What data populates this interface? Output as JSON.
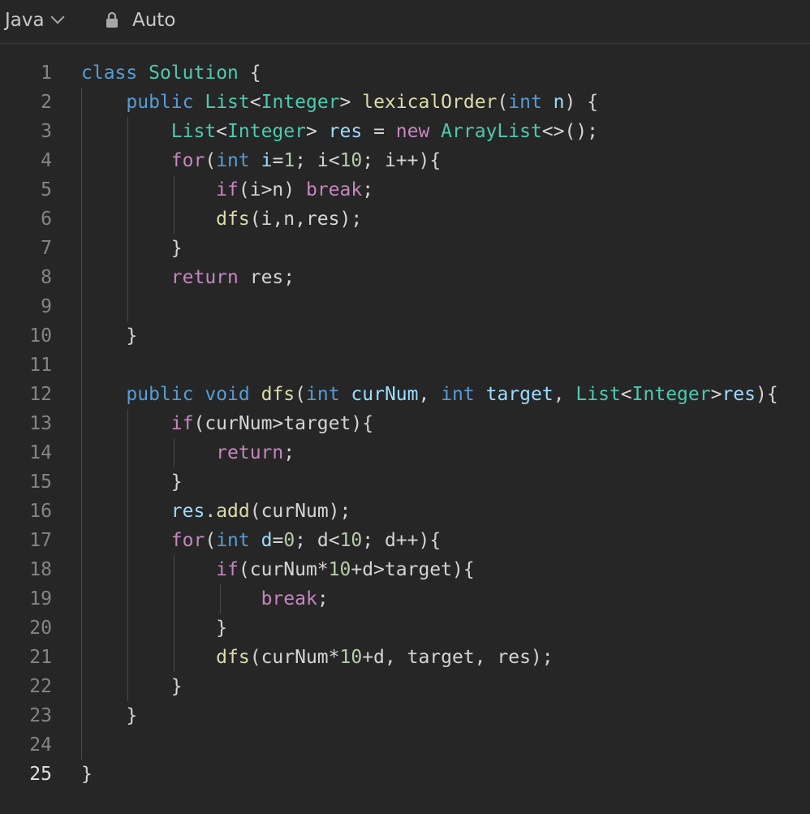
{
  "toolbar": {
    "language": "Java",
    "mode": "Auto"
  },
  "editor": {
    "active_line": 25,
    "lines": [
      {
        "n": "1",
        "tokens": [
          [
            "kw",
            "class"
          ],
          [
            "plain",
            " "
          ],
          [
            "type",
            "Solution"
          ],
          [
            "plain",
            " {"
          ]
        ]
      },
      {
        "n": "2",
        "tokens": [
          [
            "plain",
            "    "
          ],
          [
            "kw",
            "public"
          ],
          [
            "plain",
            " "
          ],
          [
            "type",
            "List"
          ],
          [
            "plain",
            "<"
          ],
          [
            "type",
            "Integer"
          ],
          [
            "plain",
            "> "
          ],
          [
            "fn",
            "lexicalOrder"
          ],
          [
            "plain",
            "("
          ],
          [
            "kw",
            "int"
          ],
          [
            "plain",
            " "
          ],
          [
            "var",
            "n"
          ],
          [
            "plain",
            ") {"
          ]
        ]
      },
      {
        "n": "3",
        "tokens": [
          [
            "plain",
            "        "
          ],
          [
            "type",
            "List"
          ],
          [
            "plain",
            "<"
          ],
          [
            "type",
            "Integer"
          ],
          [
            "plain",
            "> "
          ],
          [
            "var",
            "res"
          ],
          [
            "plain",
            " = "
          ],
          [
            "ctl",
            "new"
          ],
          [
            "plain",
            " "
          ],
          [
            "type",
            "ArrayList"
          ],
          [
            "plain",
            "<>();"
          ]
        ]
      },
      {
        "n": "4",
        "tokens": [
          [
            "plain",
            "        "
          ],
          [
            "ctl",
            "for"
          ],
          [
            "plain",
            "("
          ],
          [
            "kw",
            "int"
          ],
          [
            "plain",
            " "
          ],
          [
            "var",
            "i"
          ],
          [
            "plain",
            "="
          ],
          [
            "num",
            "1"
          ],
          [
            "plain",
            "; i<"
          ],
          [
            "num",
            "10"
          ],
          [
            "plain",
            "; i++){"
          ]
        ]
      },
      {
        "n": "5",
        "tokens": [
          [
            "plain",
            "            "
          ],
          [
            "ctl",
            "if"
          ],
          [
            "plain",
            "(i>n) "
          ],
          [
            "ctl",
            "break"
          ],
          [
            "plain",
            ";"
          ]
        ]
      },
      {
        "n": "6",
        "tokens": [
          [
            "plain",
            "            "
          ],
          [
            "fn",
            "dfs"
          ],
          [
            "plain",
            "(i,n,res);"
          ]
        ]
      },
      {
        "n": "7",
        "tokens": [
          [
            "plain",
            "        }"
          ]
        ]
      },
      {
        "n": "8",
        "tokens": [
          [
            "plain",
            "        "
          ],
          [
            "ctl",
            "return"
          ],
          [
            "plain",
            " res;"
          ]
        ]
      },
      {
        "n": "9",
        "tokens": []
      },
      {
        "n": "10",
        "tokens": [
          [
            "plain",
            "    }"
          ]
        ]
      },
      {
        "n": "11",
        "tokens": []
      },
      {
        "n": "12",
        "tokens": [
          [
            "plain",
            "    "
          ],
          [
            "kw",
            "public"
          ],
          [
            "plain",
            " "
          ],
          [
            "kw",
            "void"
          ],
          [
            "plain",
            " "
          ],
          [
            "fn",
            "dfs"
          ],
          [
            "plain",
            "("
          ],
          [
            "kw",
            "int"
          ],
          [
            "plain",
            " "
          ],
          [
            "var",
            "curNum"
          ],
          [
            "plain",
            ", "
          ],
          [
            "kw",
            "int"
          ],
          [
            "plain",
            " "
          ],
          [
            "var",
            "target"
          ],
          [
            "plain",
            ", "
          ],
          [
            "type",
            "List"
          ],
          [
            "plain",
            "<"
          ],
          [
            "type",
            "Integer"
          ],
          [
            "plain",
            ">"
          ],
          [
            "var",
            "res"
          ],
          [
            "plain",
            "){"
          ]
        ]
      },
      {
        "n": "13",
        "tokens": [
          [
            "plain",
            "        "
          ],
          [
            "ctl",
            "if"
          ],
          [
            "plain",
            "(curNum>target){"
          ]
        ]
      },
      {
        "n": "14",
        "tokens": [
          [
            "plain",
            "            "
          ],
          [
            "ctl",
            "return"
          ],
          [
            "plain",
            ";"
          ]
        ]
      },
      {
        "n": "15",
        "tokens": [
          [
            "plain",
            "        }"
          ]
        ]
      },
      {
        "n": "16",
        "tokens": [
          [
            "plain",
            "        "
          ],
          [
            "var",
            "res"
          ],
          [
            "plain",
            "."
          ],
          [
            "fn",
            "add"
          ],
          [
            "plain",
            "(curNum);"
          ]
        ]
      },
      {
        "n": "17",
        "tokens": [
          [
            "plain",
            "        "
          ],
          [
            "ctl",
            "for"
          ],
          [
            "plain",
            "("
          ],
          [
            "kw",
            "int"
          ],
          [
            "plain",
            " "
          ],
          [
            "var",
            "d"
          ],
          [
            "plain",
            "="
          ],
          [
            "num",
            "0"
          ],
          [
            "plain",
            "; d<"
          ],
          [
            "num",
            "10"
          ],
          [
            "plain",
            "; d++){"
          ]
        ]
      },
      {
        "n": "18",
        "tokens": [
          [
            "plain",
            "            "
          ],
          [
            "ctl",
            "if"
          ],
          [
            "plain",
            "(curNum*"
          ],
          [
            "num",
            "10"
          ],
          [
            "plain",
            "+d>target){"
          ]
        ]
      },
      {
        "n": "19",
        "tokens": [
          [
            "plain",
            "                "
          ],
          [
            "ctl",
            "break"
          ],
          [
            "plain",
            ";"
          ]
        ]
      },
      {
        "n": "20",
        "tokens": [
          [
            "plain",
            "            }"
          ]
        ]
      },
      {
        "n": "21",
        "tokens": [
          [
            "plain",
            "            "
          ],
          [
            "fn",
            "dfs"
          ],
          [
            "plain",
            "(curNum*"
          ],
          [
            "num",
            "10"
          ],
          [
            "plain",
            "+d, target, res);"
          ]
        ]
      },
      {
        "n": "22",
        "tokens": [
          [
            "plain",
            "        }"
          ]
        ]
      },
      {
        "n": "23",
        "tokens": [
          [
            "plain",
            "    }"
          ]
        ]
      },
      {
        "n": "24",
        "tokens": []
      },
      {
        "n": "25",
        "tokens": [
          [
            "plain",
            "}"
          ]
        ]
      }
    ]
  }
}
